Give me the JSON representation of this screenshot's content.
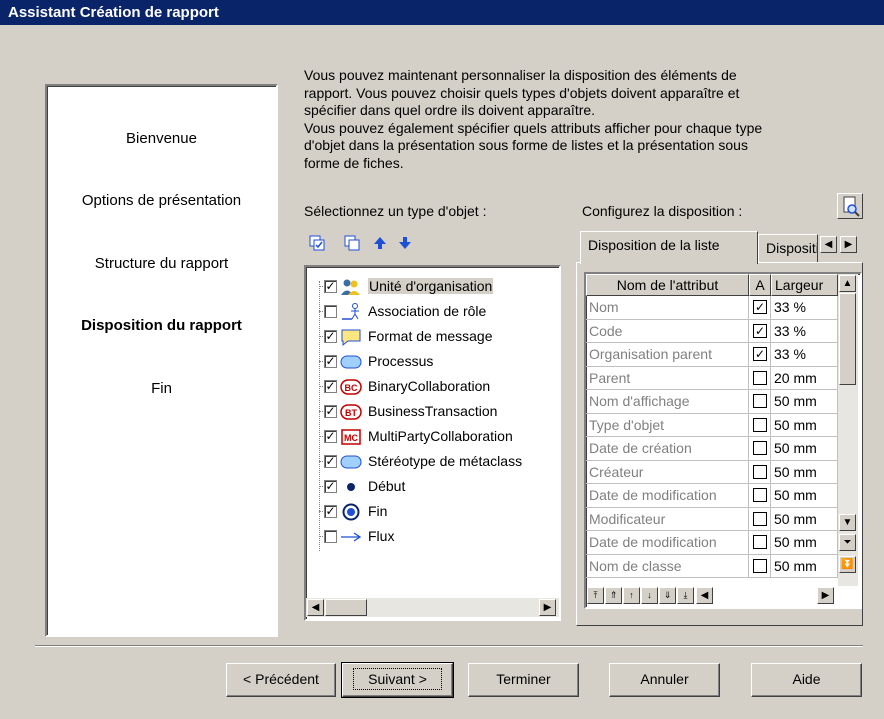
{
  "window": {
    "title": "Assistant Création de rapport"
  },
  "steps": [
    {
      "label": "Bienvenue",
      "active": false
    },
    {
      "label": "Options de présentation",
      "active": false
    },
    {
      "label": "Structure du rapport",
      "active": false
    },
    {
      "label": "Disposition du rapport",
      "active": true
    },
    {
      "label": "Fin",
      "active": false
    }
  ],
  "description": {
    "line1": "Vous pouvez maintenant personnaliser la disposition des éléments de",
    "line2": "rapport. Vous pouvez choisir quels types d'objets doivent apparaître et",
    "line3": "spécifier dans quel ordre ils doivent apparaître.",
    "line4": "Vous pouvez également spécifier quels attributs afficher pour chaque type",
    "line5": "d'objet dans la présentation sous forme de listes et la présentation sous",
    "line6": "forme de fiches."
  },
  "object_types": {
    "label": "Sélectionnez un type d'objet :",
    "items": [
      {
        "label": "Unité d'organisation",
        "checked": true,
        "icon": "org-unit-icon",
        "selected": true
      },
      {
        "label": "Association de rôle",
        "checked": false,
        "icon": "role-association-icon"
      },
      {
        "label": "Format de message",
        "checked": true,
        "icon": "message-format-icon"
      },
      {
        "label": "Processus",
        "checked": true,
        "icon": "process-icon"
      },
      {
        "label": "BinaryCollaboration",
        "checked": true,
        "icon": "binary-collaboration-icon",
        "badge": "BC"
      },
      {
        "label": "BusinessTransaction",
        "checked": true,
        "icon": "business-transaction-icon",
        "badge": "BT"
      },
      {
        "label": "MultiPartyCollaboration",
        "checked": true,
        "icon": "multiparty-collaboration-icon",
        "badge": "MC"
      },
      {
        "label": "Stéréotype de métaclass",
        "checked": true,
        "icon": "stereotype-icon"
      },
      {
        "label": "Début",
        "checked": true,
        "icon": "start-icon"
      },
      {
        "label": "Fin",
        "checked": true,
        "icon": "end-icon"
      },
      {
        "label": "Flux",
        "checked": false,
        "icon": "flow-icon"
      }
    ]
  },
  "layout_config": {
    "label": "Configurez la disposition :",
    "tabs": [
      {
        "label": "Disposition de la liste",
        "active": true
      },
      {
        "label": "Disposition des fiches",
        "active": false
      }
    ],
    "columns": [
      "Nom de l'attribut",
      "A",
      "Largeur"
    ],
    "rows": [
      {
        "name": "Nom",
        "checked": true,
        "width": "33 %"
      },
      {
        "name": "Code",
        "checked": true,
        "width": "33 %"
      },
      {
        "name": "Organisation parent",
        "checked": true,
        "width": "33 %"
      },
      {
        "name": "Parent",
        "checked": false,
        "width": "20 mm"
      },
      {
        "name": "Nom d'affichage",
        "checked": false,
        "width": "50 mm"
      },
      {
        "name": "Type d'objet",
        "checked": false,
        "width": "50 mm"
      },
      {
        "name": "Date de création",
        "checked": false,
        "width": "50 mm"
      },
      {
        "name": "Créateur",
        "checked": false,
        "width": "50 mm"
      },
      {
        "name": "Date de modification",
        "checked": false,
        "width": "50 mm"
      },
      {
        "name": "Modificateur",
        "checked": false,
        "width": "50 mm"
      },
      {
        "name": "Date de modification",
        "checked": false,
        "width": "50 mm"
      },
      {
        "name": "Nom de classe",
        "checked": false,
        "width": "50 mm"
      }
    ]
  },
  "buttons": {
    "previous": "< Précédent",
    "next": "Suivant >",
    "finish": "Terminer",
    "cancel": "Annuler",
    "help": "Aide"
  },
  "colors": {
    "title_bar": "#0a246a",
    "face": "#d4d0c8",
    "accent_blue": "#1f4fd6"
  }
}
